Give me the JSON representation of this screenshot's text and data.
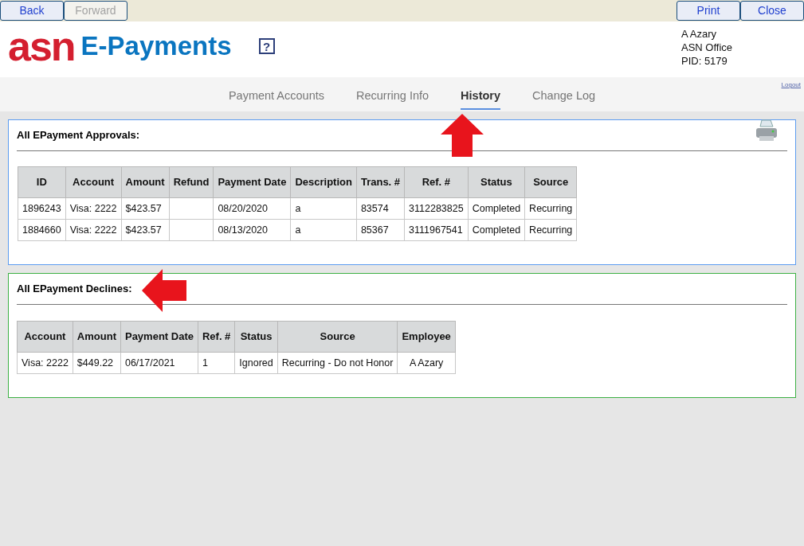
{
  "toolbar": {
    "left": [
      {
        "label": "Back",
        "disabled": false
      },
      {
        "label": "Forward",
        "disabled": true
      }
    ],
    "right": [
      {
        "label": "Print",
        "disabled": false
      },
      {
        "label": "Close",
        "disabled": false
      }
    ]
  },
  "logo": {
    "mark": "asn",
    "name": "E-Payments"
  },
  "help": "?",
  "user": [
    "A Azary",
    "ASN Office",
    "PID: 5179"
  ],
  "logout": "Logout",
  "tabs": [
    {
      "label": "Payment Accounts",
      "selected": false
    },
    {
      "label": "Recurring Info",
      "selected": false
    },
    {
      "label": "History",
      "selected": true
    },
    {
      "label": "Change Log",
      "selected": false
    }
  ],
  "approvals": {
    "title": "All EPayment Approvals:",
    "columns": [
      "ID",
      "Account",
      "Amount",
      "Refund",
      "Payment Date",
      "Description",
      "Trans. #",
      "Ref. #",
      "Status",
      "Source"
    ],
    "rows": [
      [
        "1896243",
        "Visa: 2222",
        "$423.57",
        "",
        "08/20/2020",
        "a",
        "83574",
        "3112283825",
        "Completed",
        "Recurring"
      ],
      [
        "1884660",
        "Visa: 2222",
        "$423.57",
        "",
        "08/13/2020",
        "a",
        "85367",
        "3111967541",
        "Completed",
        "Recurring"
      ]
    ]
  },
  "declines": {
    "title": "All EPayment Declines:",
    "columns": [
      "Account",
      "Amount",
      "Payment Date",
      "Ref. #",
      "Status",
      "Source",
      "Employee"
    ],
    "rows": [
      [
        "Visa: 2222",
        "$449.22",
        "06/17/2021",
        "1",
        "Ignored",
        "Recurring - Do not Honor",
        "A Azary"
      ]
    ]
  }
}
